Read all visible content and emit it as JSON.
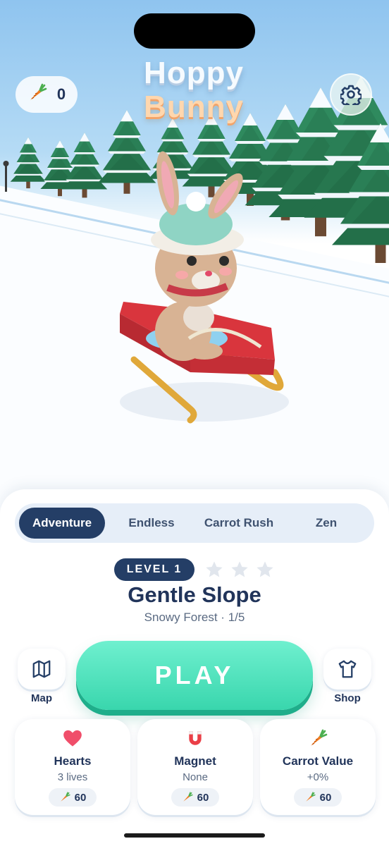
{
  "app": {
    "title_line1": "Hoppy",
    "title_line2": "Bunny"
  },
  "hud": {
    "carrot_count": "0",
    "carrot_icon": "carrot-icon",
    "settings_icon": "gear-icon"
  },
  "modes": [
    "Adventure",
    "Endless",
    "Carrot Rush",
    "Zen"
  ],
  "selected_mode": "Adventure",
  "level": {
    "badge": "LEVEL 1",
    "stars_earned": 0,
    "stars_total": 3,
    "name": "Gentle Slope",
    "subtitle": "Snowy Forest · 1/5"
  },
  "actions": {
    "map_label": "Map",
    "play_label": "PLAY",
    "shop_label": "Shop"
  },
  "powerups": [
    {
      "name": "Hearts",
      "value": "3 lives",
      "price": "60",
      "icon": "heart-icon"
    },
    {
      "name": "Magnet",
      "value": "None",
      "price": "60",
      "icon": "magnet-icon"
    },
    {
      "name": "Carrot Value",
      "value": "+0%",
      "price": "60",
      "icon": "carrot-icon"
    }
  ],
  "colors": {
    "accent": "#243e66",
    "play": "#3fdcb3",
    "text": "#21345a"
  }
}
